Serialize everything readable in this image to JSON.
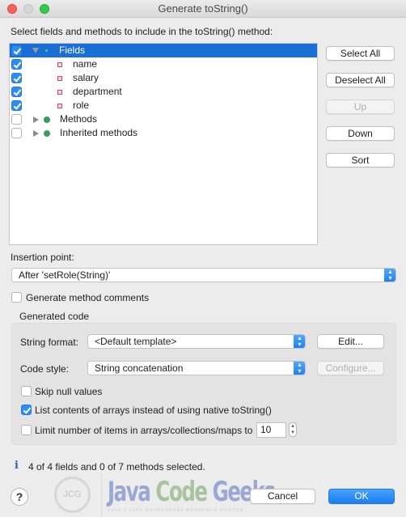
{
  "window": {
    "title": "Generate toString()"
  },
  "instruction": "Select fields and methods to include in the toString() method:",
  "tree": {
    "items": [
      {
        "label": "Fields",
        "checked": true,
        "selected": true,
        "expanded": true,
        "level": 0,
        "icon": "fields-icon"
      },
      {
        "label": "name",
        "checked": true,
        "level": 1,
        "icon": "private-field-icon"
      },
      {
        "label": "salary",
        "checked": true,
        "level": 1,
        "icon": "private-field-icon"
      },
      {
        "label": "department",
        "checked": true,
        "level": 1,
        "icon": "private-field-icon"
      },
      {
        "label": "role",
        "checked": true,
        "level": 1,
        "icon": "private-field-icon"
      },
      {
        "label": "Methods",
        "checked": false,
        "expanded": false,
        "level": 0,
        "icon": "methods-icon"
      },
      {
        "label": "Inherited methods",
        "checked": false,
        "expanded": false,
        "level": 0,
        "icon": "methods-icon"
      }
    ]
  },
  "side_buttons": {
    "select_all": "Select All",
    "deselect_all": "Deselect All",
    "up": "Up",
    "down": "Down",
    "sort": "Sort"
  },
  "insertion": {
    "label": "Insertion point:",
    "value": "After 'setRole(String)'"
  },
  "generate_comments": {
    "label": "Generate method comments",
    "checked": false
  },
  "generated_code": {
    "title": "Generated code",
    "string_format_label": "String format:",
    "string_format_value": "<Default template>",
    "edit_button": "Edit...",
    "code_style_label": "Code style:",
    "code_style_value": "String concatenation",
    "configure_button": "Configure...",
    "skip_null": {
      "label": "Skip null values",
      "checked": false
    },
    "list_arrays": {
      "label": "List contents of arrays instead of using native toString()",
      "checked": true
    },
    "limit_items": {
      "label": "Limit number of items in arrays/collections/maps to",
      "checked": false,
      "value": "10"
    }
  },
  "status": {
    "icon": "info-icon",
    "text": "4 of 4 fields and 0 of 7 methods selected."
  },
  "footer": {
    "help_symbol": "?",
    "cancel": "Cancel",
    "ok": "OK"
  },
  "watermark": {
    "circle_text": "JCG",
    "java": "Java",
    "code": "Code",
    "geeks": "Geeks",
    "subtitle": "JAVA 2 JAVA DEVELOPERS RESOURCE CENTER"
  },
  "colors": {
    "selection": "#1a6fd6",
    "checkbox_on": "#2e8df5",
    "primary_button": "#1b7ef2",
    "field_icon": "#c9485b",
    "method_icon": "#3e9a5c"
  }
}
